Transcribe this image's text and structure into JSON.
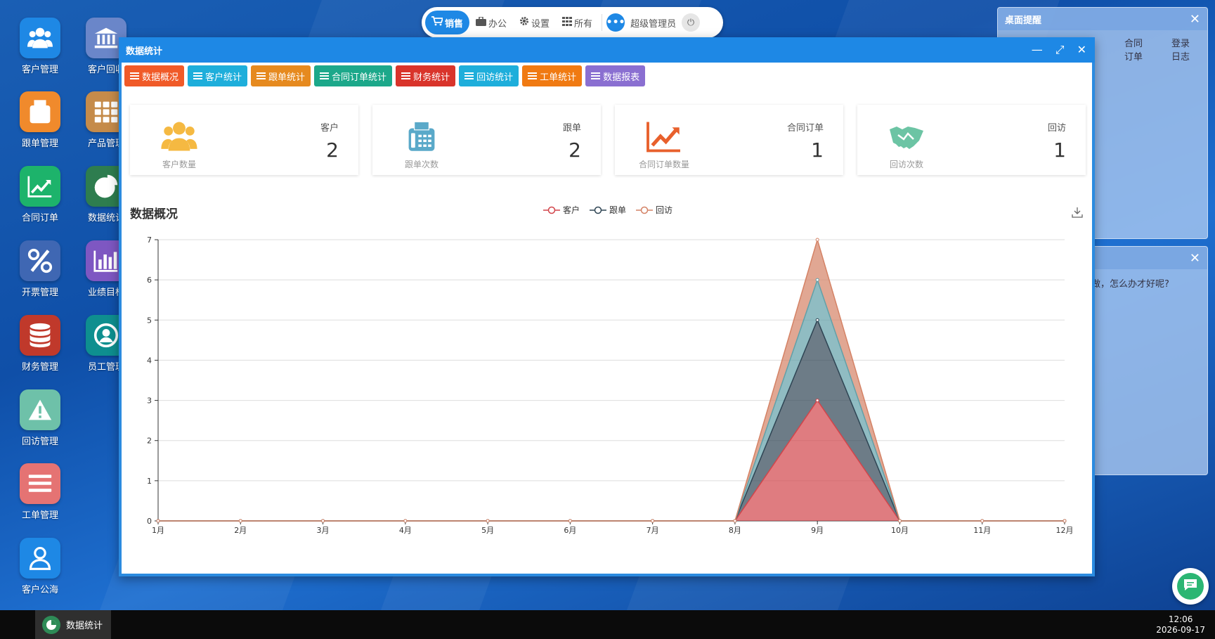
{
  "desktop_icons": [
    {
      "label": "客户管理",
      "color": "#1e88e5",
      "icon": "users-icon"
    },
    {
      "label": "客户回收",
      "color": "#6a86c9",
      "icon": "bank-icon"
    },
    {
      "label": "跟单管理",
      "color": "#f08a2c",
      "icon": "fax-icon"
    },
    {
      "label": "产品管理",
      "color": "#c58b4a",
      "icon": "grid-icon"
    },
    {
      "label": "合同订单",
      "color": "#1db36b",
      "icon": "chart-line-icon"
    },
    {
      "label": "数据统计",
      "color": "#2e7d4f",
      "icon": "pie-chart-icon"
    },
    {
      "label": "开票管理",
      "color": "#3f67b3",
      "icon": "percent-icon"
    },
    {
      "label": "业绩目标",
      "color": "#7e57c2",
      "icon": "bar-chart-icon"
    },
    {
      "label": "财务管理",
      "color": "#c0392b",
      "icon": "database-icon"
    },
    {
      "label": "员工管理",
      "color": "#0e8f8f",
      "icon": "user-circle-icon"
    },
    {
      "label": "回访管理",
      "color": "#6ec1a9",
      "icon": "warning-icon"
    },
    {
      "label": "工单管理",
      "color": "#e57373",
      "icon": "list-icon"
    },
    {
      "label": "客户公海",
      "color": "#1e88e5",
      "icon": "user-icon"
    }
  ],
  "topbar": {
    "items": [
      {
        "label": "销售",
        "icon": "cart-icon",
        "active": true
      },
      {
        "label": "办公",
        "icon": "briefcase-icon",
        "active": false
      },
      {
        "label": "设置",
        "icon": "gear-icon",
        "active": false
      },
      {
        "label": "所有",
        "icon": "apps-icon",
        "active": false
      }
    ],
    "user": "超级管理员"
  },
  "desk_reminder": {
    "title": "桌面提醒",
    "tabs": [
      "合同订单",
      "登录日志"
    ],
    "partial_text": "做，怎么办才好呢?"
  },
  "window": {
    "title": "数据统计",
    "tabs": [
      {
        "label": "数据概况",
        "color": "#f05a28"
      },
      {
        "label": "客户统计",
        "color": "#1eaedb"
      },
      {
        "label": "跟单统计",
        "color": "#e68a1f"
      },
      {
        "label": "合同订单统计",
        "color": "#1ca88a"
      },
      {
        "label": "财务统计",
        "color": "#d9342b"
      },
      {
        "label": "回访统计",
        "color": "#1eaedb"
      },
      {
        "label": "工单统计",
        "color": "#f07a12"
      },
      {
        "label": "数据报表",
        "color": "#8a6fd1"
      }
    ]
  },
  "cards": [
    {
      "name": "客户",
      "value": "2",
      "sub": "客户数量",
      "icon": "users-icon",
      "color": "#f5b942"
    },
    {
      "name": "跟单",
      "value": "2",
      "sub": "跟单次数",
      "icon": "fax-icon",
      "color": "#5aa9c9"
    },
    {
      "name": "合同订单",
      "value": "1",
      "sub": "合同订单数量",
      "icon": "chart-line-icon",
      "color": "#e8602c"
    },
    {
      "name": "回访",
      "value": "1",
      "sub": "回访次数",
      "icon": "handshake-icon",
      "color": "#6cc4a4"
    }
  ],
  "chart_title": "数据概况",
  "chart_data": {
    "type": "area",
    "categories": [
      "1月",
      "2月",
      "3月",
      "4月",
      "5月",
      "6月",
      "7月",
      "8月",
      "9月",
      "10月",
      "11月",
      "12月"
    ],
    "series": [
      {
        "name": "客户",
        "color": "#d2444a",
        "values": [
          0,
          0,
          0,
          0,
          0,
          0,
          0,
          0,
          3,
          0,
          0,
          0
        ]
      },
      {
        "name": "跟单",
        "color": "#2f4554",
        "values": [
          0,
          0,
          0,
          0,
          0,
          0,
          0,
          0,
          2,
          0,
          0,
          0
        ]
      },
      {
        "name": "跟单",
        "color": "#61a0a8",
        "values": [
          0,
          0,
          0,
          0,
          0,
          0,
          0,
          0,
          1,
          0,
          0,
          0
        ]
      },
      {
        "name": "回访",
        "color": "#d48265",
        "values": [
          0,
          0,
          0,
          0,
          0,
          0,
          0,
          0,
          1,
          0,
          0,
          0
        ]
      }
    ],
    "stacked": true,
    "ylim": [
      0,
      7
    ],
    "yticks": [
      0,
      1,
      2,
      3,
      4,
      5,
      6,
      7
    ],
    "grid": true,
    "legend_position": "top-center",
    "legend": [
      {
        "name": "客户",
        "color": "#d2444a"
      },
      {
        "name": "跟单",
        "color": "#2f4554"
      },
      {
        "name": "回访",
        "color": "#d48265"
      }
    ]
  },
  "taskbar": {
    "item": "数据统计",
    "time": "12:06",
    "date": "2026-09-17"
  }
}
